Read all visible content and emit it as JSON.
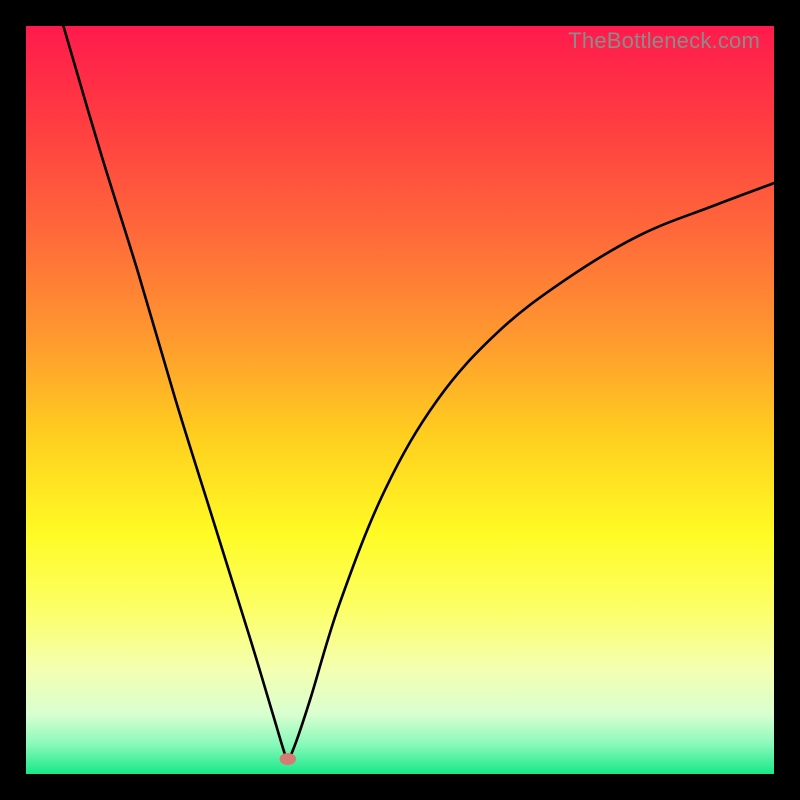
{
  "watermark": "TheBottleneck.com",
  "colors": {
    "frame": "#000000",
    "curve": "#000000",
    "marker": "#d67b73",
    "gradient_stops": [
      {
        "pct": 0,
        "color": "#ff1a4d"
      },
      {
        "pct": 12,
        "color": "#ff3a42"
      },
      {
        "pct": 28,
        "color": "#ff6a3a"
      },
      {
        "pct": 42,
        "color": "#ff9a2f"
      },
      {
        "pct": 55,
        "color": "#ffcf1f"
      },
      {
        "pct": 68,
        "color": "#fffb25"
      },
      {
        "pct": 78,
        "color": "#fcff66"
      },
      {
        "pct": 86,
        "color": "#f4ffb1"
      },
      {
        "pct": 92,
        "color": "#d9ffd0"
      },
      {
        "pct": 96,
        "color": "#89f9ba"
      },
      {
        "pct": 100,
        "color": "#17e887"
      }
    ]
  },
  "chart_data": {
    "type": "line",
    "title": "",
    "xlabel": "",
    "ylabel": "",
    "xlim": [
      0,
      100
    ],
    "ylim": [
      0,
      100
    ],
    "grid": false,
    "legend": false,
    "description": "V-shaped bottleneck curve descending from top-left to a minimum near the bottom, then rising toward the upper-right with a gentler, concave slope. Background is a vertical gradient from red (top) through orange/yellow to green (bottom).",
    "minimum_point": {
      "x": 35,
      "y": 2
    },
    "series": [
      {
        "name": "bottleneck-left",
        "x": [
          5,
          10,
          15,
          20,
          25,
          30,
          33,
          34.5,
          35
        ],
        "y": [
          100,
          83,
          67,
          50,
          34,
          18,
          8,
          3,
          2
        ]
      },
      {
        "name": "bottleneck-right",
        "x": [
          35,
          36,
          38,
          42,
          48,
          55,
          63,
          72,
          82,
          92,
          100
        ],
        "y": [
          2,
          4,
          10,
          23,
          38,
          50,
          59,
          66,
          72,
          76,
          79
        ]
      }
    ]
  }
}
